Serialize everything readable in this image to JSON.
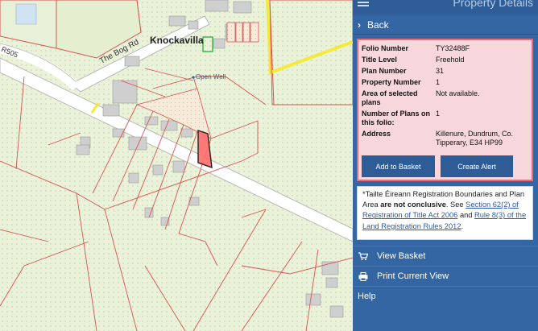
{
  "map": {
    "town_label": "Knockavilla",
    "road_label": "The Bog Rd",
    "route_label": "R505",
    "feature_label": "Open Well"
  },
  "panel": {
    "title": "Property Details",
    "back_label": "Back",
    "details": [
      {
        "label": "Folio Number",
        "value": "TY32488F"
      },
      {
        "label": "Title Level",
        "value": "Freehold"
      },
      {
        "label": "Plan Number",
        "value": "31"
      },
      {
        "label": "Property Number",
        "value": "1"
      },
      {
        "label": "Area of selected plans",
        "value": "Not available."
      },
      {
        "label": "Number of Plans on this folio:",
        "value": "1"
      },
      {
        "label": "Address",
        "value": "Killenure, Dundrum, Co. Tipperary, E34 HP99"
      }
    ],
    "add_to_basket": "Add to Basket",
    "create_alert": "Create Alert",
    "disclaimer": {
      "part1": "*Tailte Éireann Registration Boundaries and Plan Area ",
      "bold": "are not conclusive",
      "part2": ". See ",
      "link1": "Section 62(2) of Registration of Title Act 2006",
      "part3": " and ",
      "link2": "Rule 8(3) of the Land Registration Rules 2012",
      "part4": "."
    },
    "menu": {
      "view_basket": "View Basket",
      "print_view": "Print Current View",
      "help": "Help"
    }
  },
  "colors": {
    "panel_bg": "#3566a4",
    "card_bg": "#f7d7dc",
    "card_border": "#e86a7a",
    "button_bg": "#2e5c96",
    "parcel_boundary": "#d9534f",
    "selected_parcel": "#ff6b6b",
    "map_bg": "#eef3e0"
  }
}
